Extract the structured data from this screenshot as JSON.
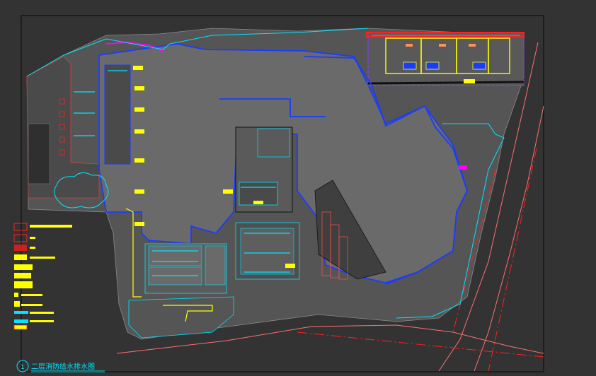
{
  "drawing": {
    "title": "二层消防给水排水图",
    "index_number": "1"
  },
  "colors": {
    "background": "#333333",
    "frame": "#111111",
    "site": "#595959",
    "building": "#6a6a6a",
    "building_dark": "#4c4c4c",
    "blue": "#1a3cff",
    "cyan": "#00e5ff",
    "yellow": "#ffff00",
    "red": "#e02020",
    "magenta": "#ff00ff",
    "purple": "#8a3cff",
    "pink": "#ff7070"
  },
  "legend": {
    "rows": 11
  }
}
